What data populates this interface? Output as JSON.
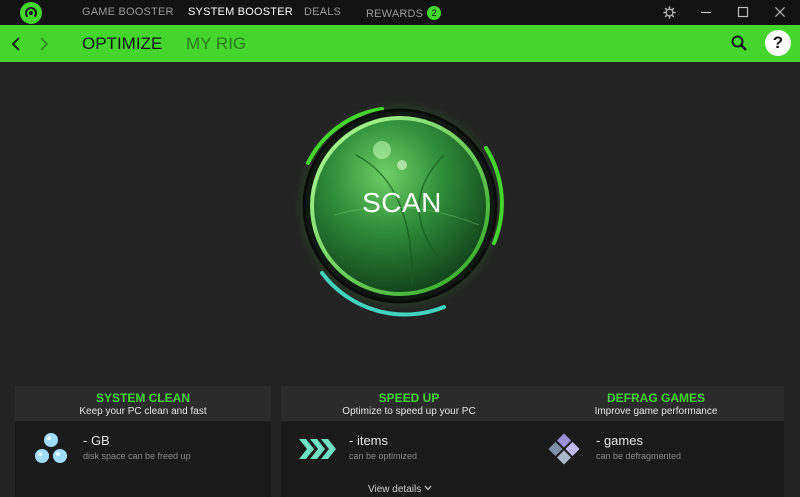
{
  "titlebar": {
    "tabs": [
      {
        "label": "GAME BOOSTER",
        "active": false
      },
      {
        "label": "SYSTEM BOOSTER",
        "active": true
      },
      {
        "label": "DEALS",
        "active": false
      },
      {
        "label": "REWARDS",
        "active": false,
        "badge": "2"
      }
    ],
    "window_controls": [
      "gear-icon",
      "minimize-icon",
      "maximize-icon",
      "close-icon"
    ]
  },
  "subnav": {
    "tabs": [
      {
        "label": "OPTIMIZE",
        "active": true
      },
      {
        "label": "MY RIG",
        "active": false
      }
    ],
    "help_label": "?"
  },
  "scan": {
    "label": "SCAN"
  },
  "cards": [
    {
      "title": "SYSTEM CLEAN",
      "subtitle": "Keep your PC clean and fast",
      "value": "- GB",
      "caption": "disk space can be freed up",
      "icon": "bubbles-icon"
    },
    {
      "title": "SPEED UP",
      "subtitle": "Optimize to speed up your PC",
      "value": "- items",
      "caption": "can be optimized",
      "icon": "chevrons-right-icon"
    },
    {
      "title": "DEFRAG GAMES",
      "subtitle": "Improve game performance",
      "value": "- games",
      "caption": "can be defragmented",
      "icon": "defrag-blocks-icon"
    }
  ],
  "footer": {
    "view_details": "View details"
  },
  "colors": {
    "accent": "#44d62c",
    "background": "#232323",
    "titlebar": "#121212",
    "card": "#1a1a1a",
    "card_header": "#2b2b2b",
    "cyan_arc": "#3fd3c0"
  }
}
